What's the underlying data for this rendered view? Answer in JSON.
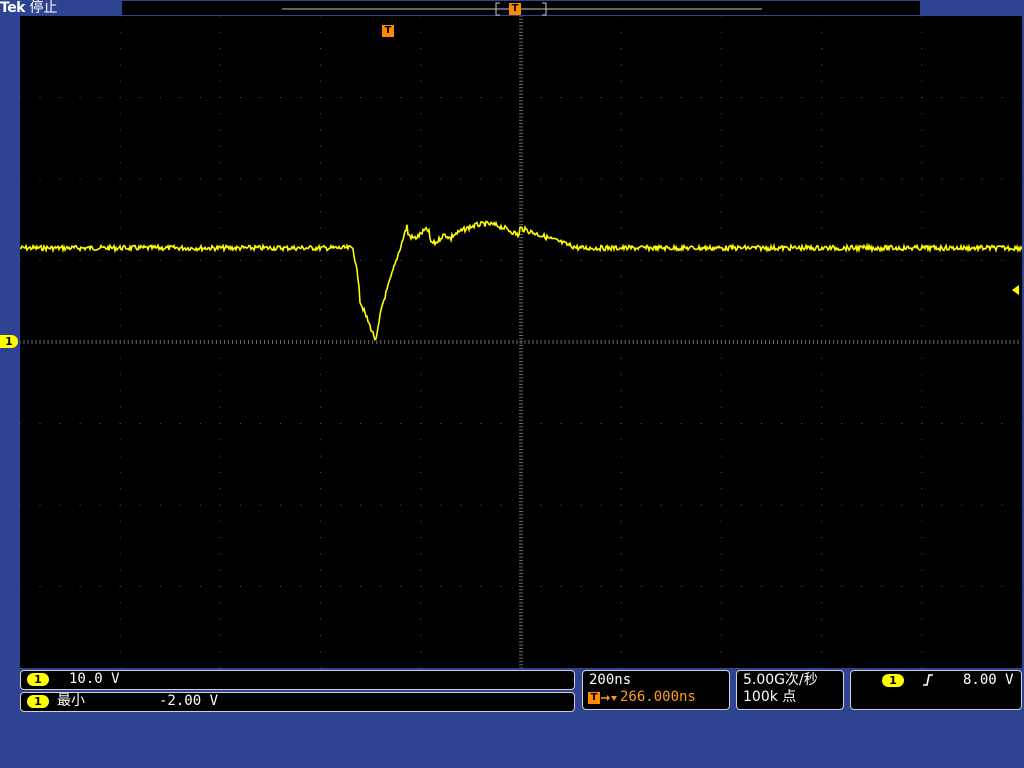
{
  "header": {
    "brand": "Tek",
    "status": "停止"
  },
  "trigger_marker_label": "T",
  "channel_marker_label": "1",
  "channel1": {
    "badge": "1",
    "scale": "10.0 V",
    "min_label": "最小",
    "min_value": "-2.00 V",
    "color": "#ffff00"
  },
  "timebase": {
    "scale": "200ns",
    "trigger_position": "266.000ns"
  },
  "acquisition": {
    "sample_rate": "5.00G次/秒",
    "record_length": "100k 点"
  },
  "trigger": {
    "source_badge": "1",
    "slope_icon": "rising-edge-icon",
    "level": "8.00 V"
  },
  "colors": {
    "background": "#2e4492",
    "screen": "#000000",
    "trace": "#ffff00",
    "trigger": "#ff8a00"
  }
}
